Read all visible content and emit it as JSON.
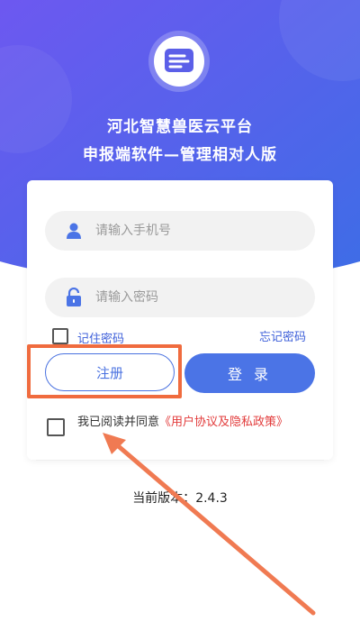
{
  "app": {
    "title_line1": "河北智慧兽医云平台",
    "title_line2": "申报端软件—管理相对人版"
  },
  "login": {
    "phone_placeholder": "请输入手机号",
    "password_placeholder": "请输入密码",
    "remember_label": "记住密码",
    "forgot_label": "忘记密码",
    "register_label": "注册",
    "login_label": "登 录"
  },
  "agreement": {
    "text": "我已阅读并同意",
    "link": "《用户协议及隐私政策》"
  },
  "footer": {
    "version_label": "当前版本：",
    "version_value": "2.4.3"
  },
  "colors": {
    "primary": "#4b74e6",
    "hero_start": "#6a5cf0",
    "hero_end": "#3f6ae6",
    "highlight": "#f06b3e",
    "link_red": "#e23b3b"
  },
  "icons": [
    "app-logo-icon",
    "user-icon",
    "lock-icon",
    "annotation-arrow"
  ]
}
